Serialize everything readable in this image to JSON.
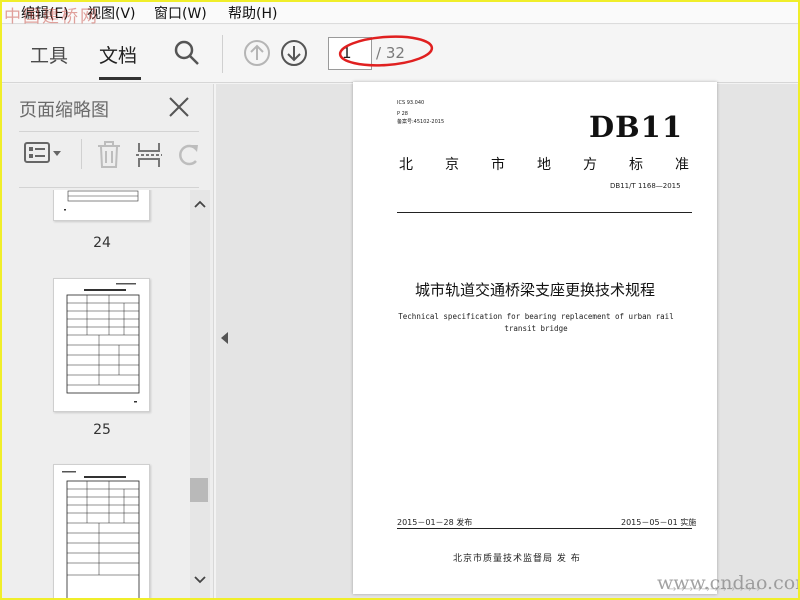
{
  "watermark": {
    "top": "中国建桥网",
    "bottom": "www.cndao.com"
  },
  "menu": {
    "edit": "编辑(E)",
    "view": "视图(V)",
    "window": "窗口(W)",
    "help": "帮助(H)"
  },
  "toolbar": {
    "tools_tab": "工具",
    "document_tab": "文档",
    "current_page": "1",
    "total_pages": "/ 32"
  },
  "thumbnail_panel": {
    "title": "页面缩略图",
    "pages": [
      "24",
      "25"
    ]
  },
  "document": {
    "ics": "ICS 93.040",
    "p_code": "P 28",
    "record_no": "备案号:45102-2015",
    "db": "DB11",
    "header_chars": [
      "北",
      "京",
      "市",
      "地",
      "方",
      "标",
      "准"
    ],
    "std_code": "DB11/T 1168—2015",
    "title_cn": "城市轨道交通桥梁支座更换技术规程",
    "title_en": "Technical specification for bearing replacement of urban rail transit bridge",
    "release_date": "2015－01－28 发布",
    "implement_date": "2015－05－01 实施",
    "issuer": "北京市质量技术监督局  发 布"
  },
  "colors": {
    "annotation_ellipse": "#e02020",
    "outer_frame": "#f0ee2a"
  }
}
